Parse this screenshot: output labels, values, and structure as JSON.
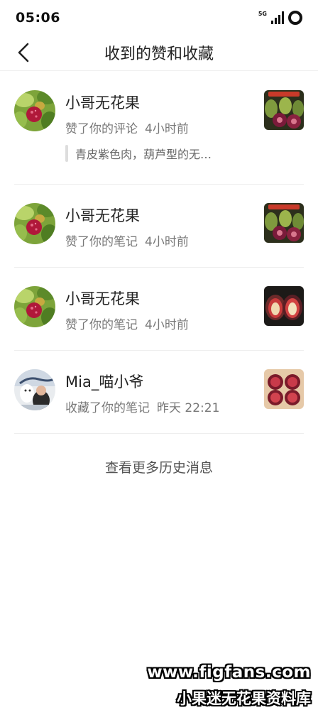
{
  "status_bar": {
    "time": "05:06",
    "network": "5G"
  },
  "header": {
    "title": "收到的赞和收藏"
  },
  "notifications": [
    {
      "name": "小哥无花果",
      "action": "赞了你的评论",
      "time": "4小时前",
      "quote": "青皮紫色肉，葫芦型的无…",
      "avatar_icon": "fig-plant-avatar",
      "thumb_icon": "figs-photo"
    },
    {
      "name": "小哥无花果",
      "action": "赞了你的笔记",
      "time": "4小时前",
      "avatar_icon": "fig-plant-avatar",
      "thumb_icon": "figs-photo"
    },
    {
      "name": "小哥无花果",
      "action": "赞了你的笔记",
      "time": "4小时前",
      "avatar_icon": "fig-plant-avatar",
      "thumb_icon": "cut-figs-photo"
    },
    {
      "name": "Mia_喵小爷",
      "action": "收藏了你的笔记",
      "time": "昨天 22:21",
      "avatar_icon": "user-photo-avatar",
      "thumb_icon": "cut-figs-photo"
    }
  ],
  "more_link": "查看更多历史消息",
  "watermark": {
    "url": "www.figfans.com",
    "name": "小果迷无花果资料库"
  }
}
